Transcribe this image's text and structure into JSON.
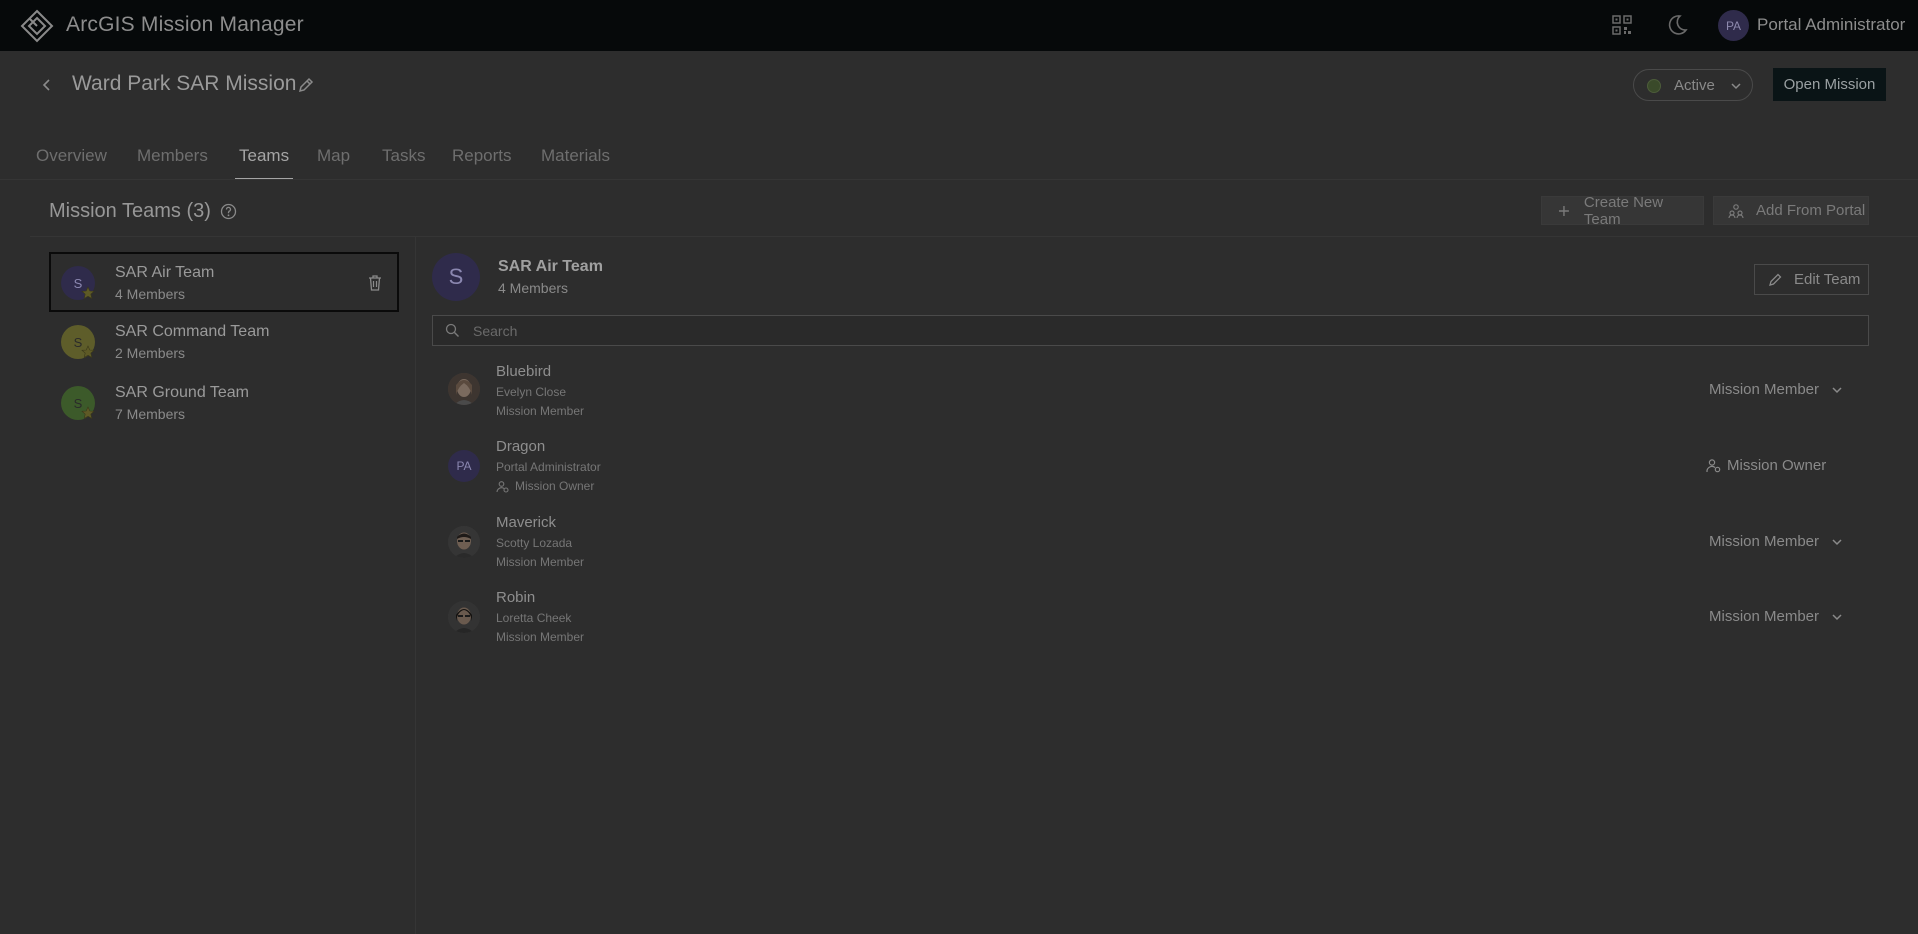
{
  "app": {
    "title": "ArcGIS Mission Manager"
  },
  "user": {
    "initials": "PA",
    "name": "Portal Administrator"
  },
  "mission": {
    "title": "Ward Park SAR Mission",
    "status": "Active",
    "open_label": "Open Mission"
  },
  "tabs": [
    {
      "label": "Overview"
    },
    {
      "label": "Members"
    },
    {
      "label": "Teams",
      "active": true
    },
    {
      "label": "Map"
    },
    {
      "label": "Tasks"
    },
    {
      "label": "Reports"
    },
    {
      "label": "Materials"
    }
  ],
  "section": {
    "title": "Mission Teams (3)",
    "create_label": "Create New Team",
    "add_portal_label": "Add From Portal"
  },
  "teams": [
    {
      "initial": "S",
      "name": "SAR Air Team",
      "count": "4 Members",
      "color": "#2f2b4b",
      "selected": true
    },
    {
      "initial": "S",
      "name": "SAR Command Team",
      "count": "2 Members",
      "color": "#5e5d2a"
    },
    {
      "initial": "S",
      "name": "SAR Ground Team",
      "count": "7 Members",
      "color": "#3c5a2a"
    }
  ],
  "detail": {
    "initial": "S",
    "name": "SAR Air Team",
    "count": "4 Members",
    "edit_label": "Edit Team",
    "search_placeholder": "Search"
  },
  "members": [
    {
      "callsign": "Bluebird",
      "fullname": "Evelyn Close",
      "role_sub": "Mission Member",
      "role": "Mission Member"
    },
    {
      "callsign": "Dragon",
      "fullname": "Portal Administrator",
      "role_sub": "Mission Owner",
      "role": "Mission Owner",
      "initials": "PA"
    },
    {
      "callsign": "Maverick",
      "fullname": "Scotty Lozada",
      "role_sub": "Mission Member",
      "role": "Mission Member"
    },
    {
      "callsign": "Robin",
      "fullname": "Loretta Cheek",
      "role_sub": "Mission Member",
      "role": "Mission Member"
    }
  ],
  "colors": {
    "topbar": "#06090a",
    "background": "#2d2d2d",
    "accent_purple": "#2f2b4b",
    "status_green": "#3a4a2a"
  }
}
